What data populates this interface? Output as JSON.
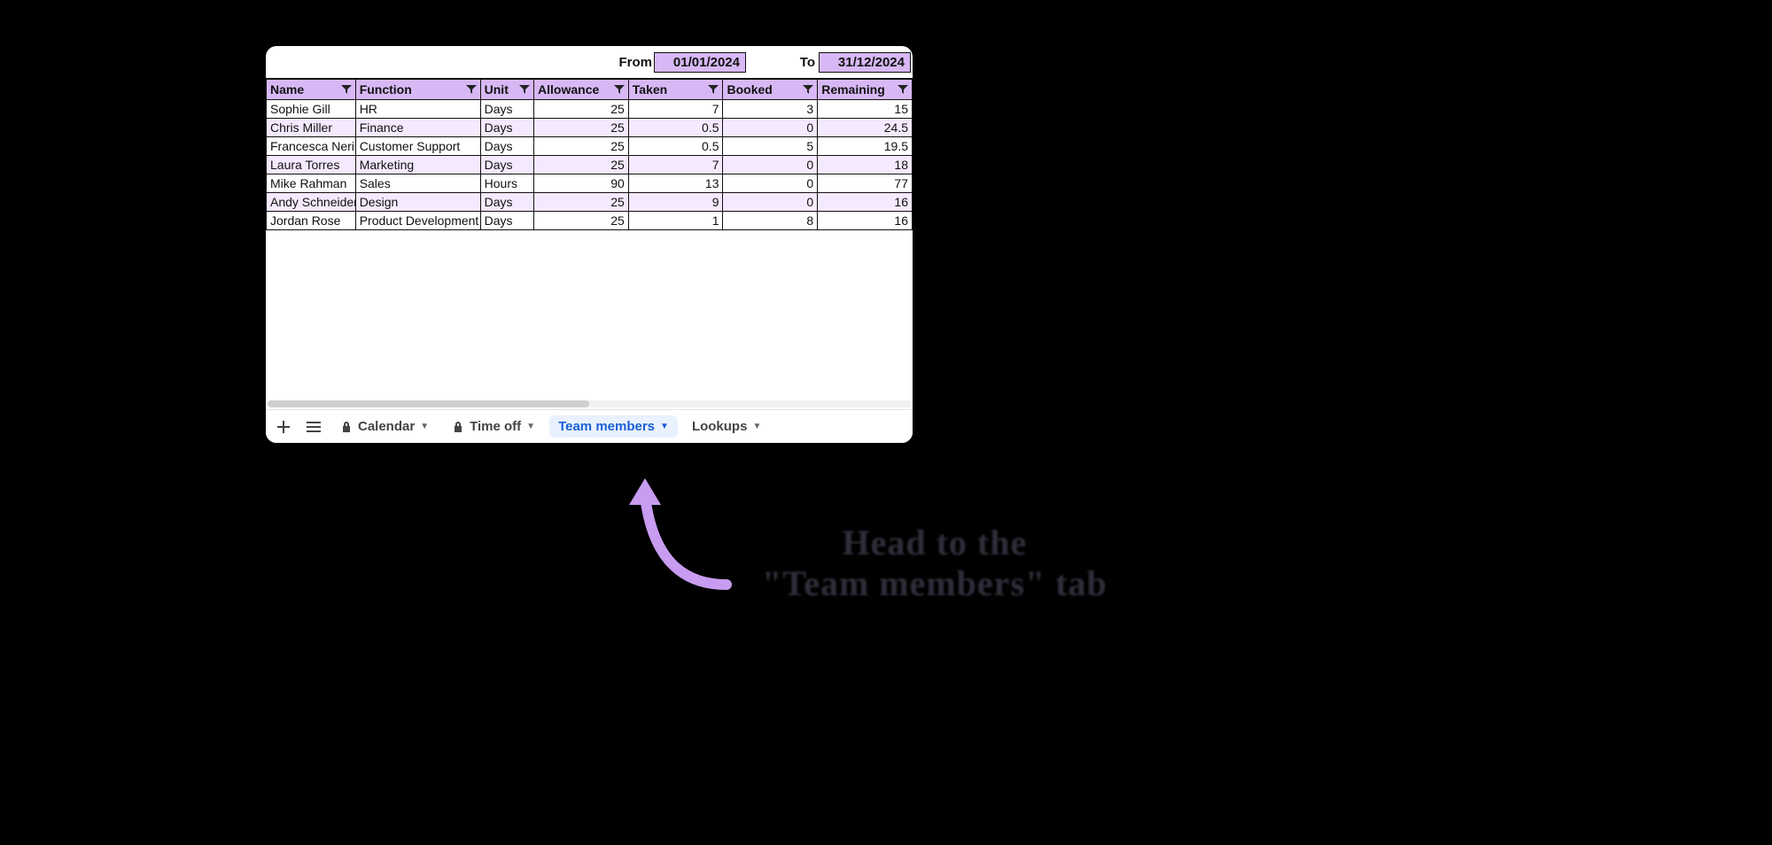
{
  "dateRange": {
    "fromLabel": "From",
    "from": "01/01/2024",
    "toLabel": "To",
    "to": "31/12/2024"
  },
  "headers": {
    "name": "Name",
    "function": "Function",
    "unit": "Unit",
    "allowance": "Allowance",
    "taken": "Taken",
    "booked": "Booked",
    "remaining": "Remaining"
  },
  "rows": [
    {
      "name": "Sophie Gill",
      "function": "HR",
      "unit": "Days",
      "allowance": "25",
      "taken": "7",
      "booked": "3",
      "remaining": "15"
    },
    {
      "name": "Chris Miller",
      "function": "Finance",
      "unit": "Days",
      "allowance": "25",
      "taken": "0.5",
      "booked": "0",
      "remaining": "24.5"
    },
    {
      "name": "Francesca Neri",
      "function": "Customer Support",
      "unit": "Days",
      "allowance": "25",
      "taken": "0.5",
      "booked": "5",
      "remaining": "19.5"
    },
    {
      "name": "Laura Torres",
      "function": "Marketing",
      "unit": "Days",
      "allowance": "25",
      "taken": "7",
      "booked": "0",
      "remaining": "18"
    },
    {
      "name": "Mike Rahman",
      "function": "Sales",
      "unit": "Hours",
      "allowance": "90",
      "taken": "13",
      "booked": "0",
      "remaining": "77"
    },
    {
      "name": "Andy Schneider",
      "function": "Design",
      "unit": "Days",
      "allowance": "25",
      "taken": "9",
      "booked": "0",
      "remaining": "16"
    },
    {
      "name": "Jordan Rose",
      "function": "Product Development",
      "unit": "Days",
      "allowance": "25",
      "taken": "1",
      "booked": "8",
      "remaining": "16"
    }
  ],
  "tabs": {
    "calendar": "Calendar",
    "timeoff": "Time off",
    "team": "Team members",
    "lookups": "Lookups"
  },
  "annotation": {
    "line1": "Head to the",
    "line2": "\"Team members\" tab"
  }
}
